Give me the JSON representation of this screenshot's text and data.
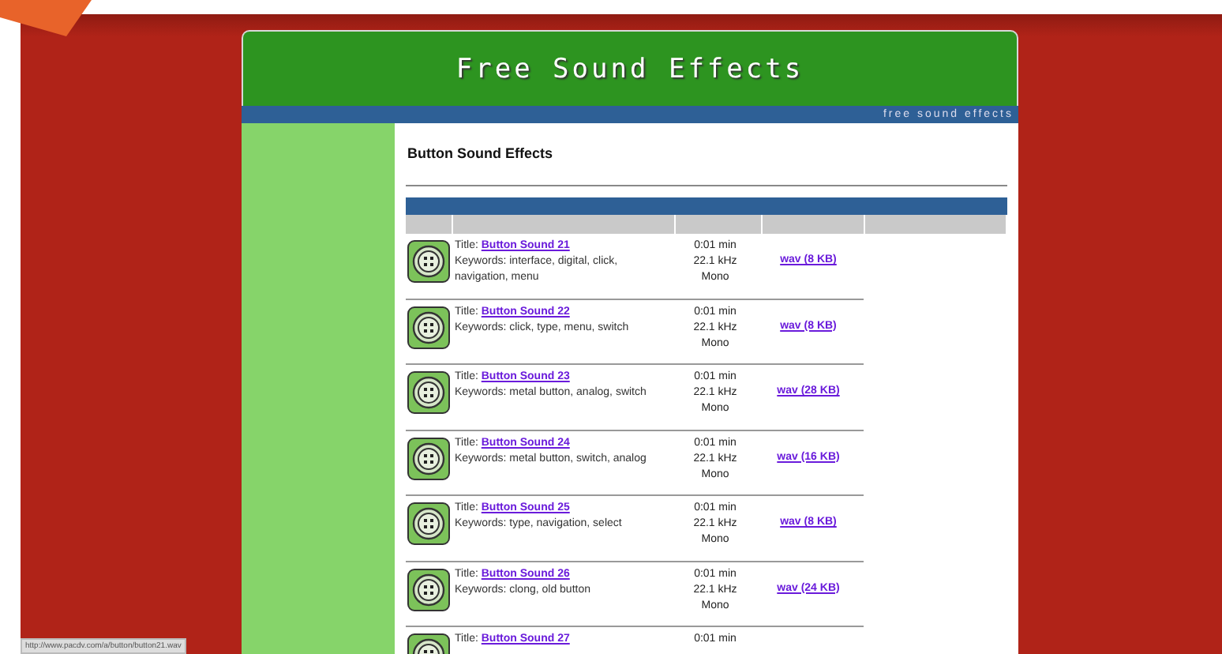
{
  "header": {
    "title": "Free Sound Effects",
    "tagline": "free sound effects"
  },
  "heading": "Button Sound Effects",
  "sounds": [
    {
      "title_label": "Title:",
      "title": "Button Sound 21",
      "keywords": "Keywords: interface, digital, click, navigation, menu",
      "duration": "0:01 min",
      "rate": "22.1 kHz",
      "channels": "Mono",
      "download": "wav (8 KB)"
    },
    {
      "title_label": "Title:",
      "title": "Button Sound 22",
      "keywords": "Keywords: click, type, menu, switch",
      "duration": "0:01 min",
      "rate": "22.1 kHz",
      "channels": "Mono",
      "download": "wav (8 KB)"
    },
    {
      "title_label": "Title:",
      "title": "Button Sound 23",
      "keywords": "Keywords: metal button, analog, switch",
      "duration": "0:01 min",
      "rate": "22.1 kHz",
      "channels": "Mono",
      "download": "wav (28 KB)"
    },
    {
      "title_label": "Title:",
      "title": "Button Sound 24",
      "keywords": "Keywords: metal button, switch, analog",
      "duration": "0:01 min",
      "rate": "22.1 kHz",
      "channels": "Mono",
      "download": "wav (16 KB)"
    },
    {
      "title_label": "Title:",
      "title": "Button Sound 25",
      "keywords": "Keywords: type, navigation, select",
      "duration": "0:01 min",
      "rate": "22.1 kHz",
      "channels": "Mono",
      "download": "wav (8 KB)"
    },
    {
      "title_label": "Title:",
      "title": "Button Sound 26",
      "keywords": "Keywords: clong, old button",
      "duration": "0:01 min",
      "rate": "22.1 kHz",
      "channels": "Mono",
      "download": "wav (24 KB)"
    },
    {
      "title_label": "Title:",
      "title": "Button Sound 27",
      "duration": "0:01 min"
    }
  ],
  "status_url": "http://www.pacdv.com/a/button/button21.wav"
}
